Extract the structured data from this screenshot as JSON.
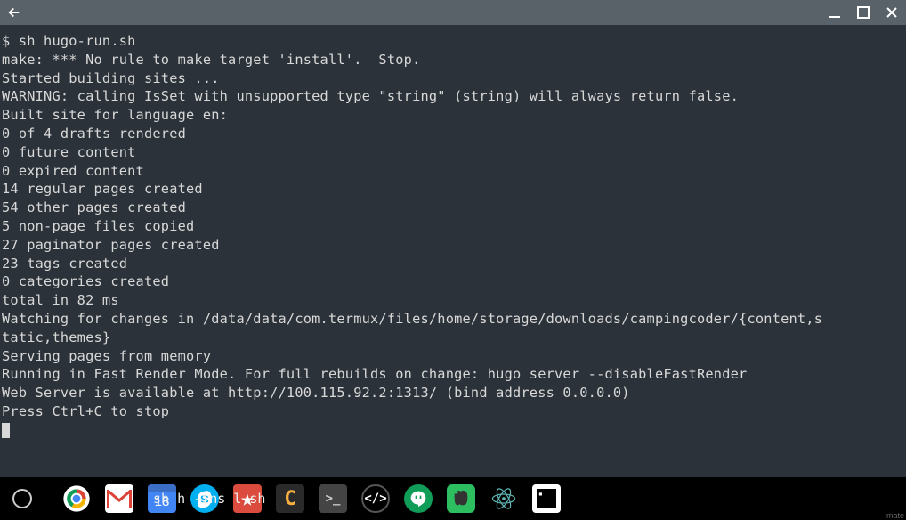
{
  "titlebar": {
    "back": "←",
    "minimize": "_",
    "maximize": "□",
    "close": "×"
  },
  "terminal": {
    "prompt": "$ sh hugo-run.sh",
    "lines": [
      "make: *** No rule to make target 'install'.  Stop.",
      "Started building sites ...",
      "WARNING: calling IsSet with unsupported type \"string\" (string) will always return false.",
      "",
      "",
      "Built site for language en:",
      "0 of 4 drafts rendered",
      "0 future content",
      "0 expired content",
      "14 regular pages created",
      "54 other pages created",
      "5 non-page files copied",
      "27 paginator pages created",
      "23 tags created",
      "0 categories created",
      "total in 82 ms",
      "Watching for changes in /data/data/com.termux/files/home/storage/downloads/campingcoder/{content,s",
      "tatic,themes}",
      "Serving pages from memory",
      "Running in Fast Render Mode. For full rebuilds on change: hugo server --disableFastRender",
      "Web Server is available at http://100.115.92.2:1313/ (bind address 0.0.0.0)",
      "Press Ctrl+C to stop"
    ]
  },
  "taskbar": {
    "overlay_text": "sh h   -ins    l.sh",
    "calendar_day": "18",
    "right_text": "mate"
  }
}
